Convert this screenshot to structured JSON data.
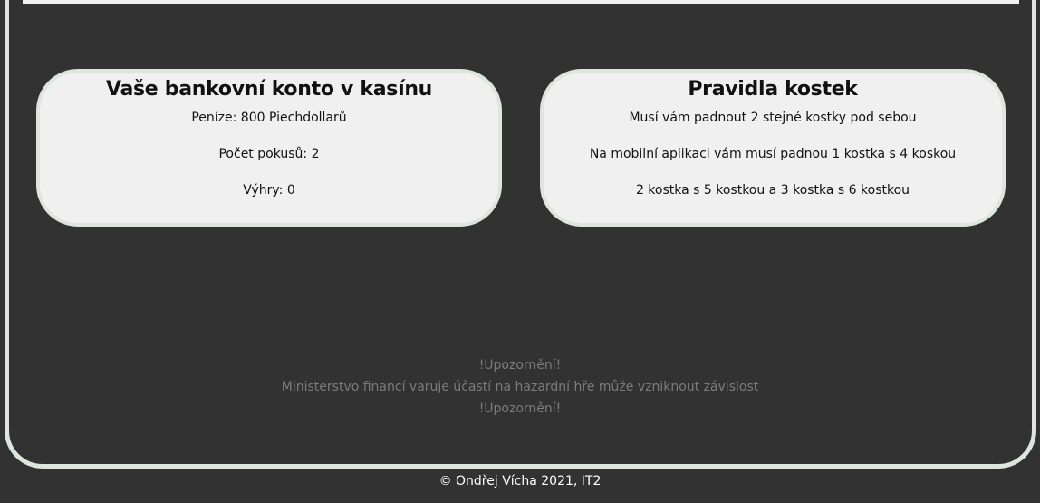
{
  "account": {
    "title": "Vaše bankovní konto v kasínu",
    "money": "Peníze: 800 Piechdollarů",
    "attempts": "Počet pokusů: 2",
    "wins": "Výhry: 0"
  },
  "rules": {
    "title": "Pravidla kostek",
    "lines": [
      "Musí vám padnout 2 stejné kostky pod sebou",
      "Na mobilní aplikaci vám musí padnou 1 kostka s 4 koskou",
      "2 kostka s 5 kostkou a 3 kostka s 6 kostkou"
    ]
  },
  "warning": {
    "heading": "!Upozornění!",
    "text": "Ministerstvo financí varuje účastí na hazardní hře může vzniknout závislost",
    "footer_heading": "!Upozornění!"
  },
  "footer": {
    "copyright": "© Ondřej Vícha 2021, IT2"
  },
  "colors": {
    "background": "#323232",
    "card": "#f0f0f0",
    "border": "#dde6dd",
    "warning_text": "#7b7b7b"
  }
}
